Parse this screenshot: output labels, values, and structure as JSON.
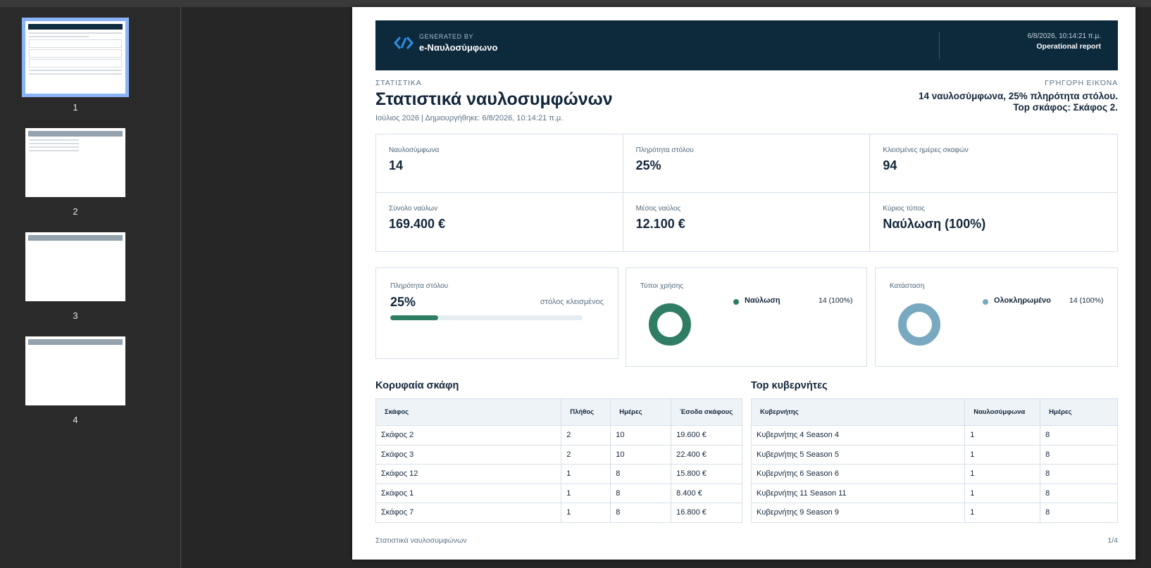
{
  "sidebar": {
    "thumbnails": [
      {
        "label": "1"
      },
      {
        "label": "2"
      },
      {
        "label": "3"
      },
      {
        "label": "4"
      }
    ]
  },
  "header": {
    "generated_by": "GENERATED BY",
    "brand": "e-Ναυλοσύμφωνο",
    "date": "6/8/2026, 10:14:21 π.μ.",
    "report_type": "Operational report"
  },
  "intro": {
    "eyebrow": "ΣΤΑΤΙΣΤΙΚΑ",
    "title": "Στατιστικά ναυλοσυμφώνων",
    "subline": "Ιούλιος 2026 | Δημιουργήθηκε: 6/8/2026, 10:14:21 π.μ.",
    "quick_label": "ΓΡΉΓΟΡΗ ΕΙΚΌΝΑ",
    "quick_text": "14 ναυλοσύμφωνα, 25% πληρότητα στόλου. Top σκάφος: Σκάφος 2."
  },
  "kpis": [
    {
      "label": "Ναυλοσύμφωνα",
      "value": "14"
    },
    {
      "label": "Πληρότητα στόλου",
      "value": "25%"
    },
    {
      "label": "Κλεισμένες ημέρες σκαφών",
      "value": "94"
    },
    {
      "label": "Σύνολο ναύλων",
      "value": "169.400 €"
    },
    {
      "label": "Μέσος ναύλος",
      "value": "12.100 €"
    },
    {
      "label": "Κύριος τύπος",
      "value": "Ναύλωση (100%)"
    }
  ],
  "fleet_fill": {
    "label": "Πληρότητα στόλου",
    "value": "25%",
    "fraction": 0.25,
    "note": "στόλος κλεισμένος",
    "color": "#2f7d64"
  },
  "usage_types": {
    "label": "Τύποι χρήσης",
    "color": "#2f7d64",
    "items": [
      {
        "name": "Ναύλωση",
        "value": "14 (100%)"
      }
    ]
  },
  "status": {
    "label": "Κατάσταση",
    "color": "#79a9c0",
    "items": [
      {
        "name": "Ολοκληρωμένο",
        "value": "14 (100%)"
      }
    ]
  },
  "top_vessels": {
    "title": "Κορυφαία σκάφη",
    "columns": [
      "Σκάφος",
      "Πλήθος",
      "Ημέρες",
      "Έσοδα σκάφους"
    ],
    "rows": [
      [
        "Σκάφος 2",
        "2",
        "10",
        "19.600 €"
      ],
      [
        "Σκάφος 3",
        "2",
        "10",
        "22.400 €"
      ],
      [
        "Σκάφος 12",
        "1",
        "8",
        "15.800 €"
      ],
      [
        "Σκάφος 1",
        "1",
        "8",
        "8.400 €"
      ],
      [
        "Σκάφος 7",
        "1",
        "8",
        "16.800 €"
      ]
    ]
  },
  "top_skippers": {
    "title": "Top κυβερνήτες",
    "columns": [
      "Κυβερνήτης",
      "Ναυλοσύμφωνα",
      "Ημέρες"
    ],
    "rows": [
      [
        "Κυβερνήτης 4 Season 4",
        "1",
        "8"
      ],
      [
        "Κυβερνήτης 5 Season 5",
        "1",
        "8"
      ],
      [
        "Κυβερνήτης 6 Season 6",
        "1",
        "8"
      ],
      [
        "Κυβερνήτης 11 Season 11",
        "1",
        "8"
      ],
      [
        "Κυβερνήτης 9 Season 9",
        "1",
        "8"
      ]
    ]
  },
  "footer": {
    "left": "Στατιστικά ναυλοσυμφώνων",
    "right": "1/4"
  }
}
